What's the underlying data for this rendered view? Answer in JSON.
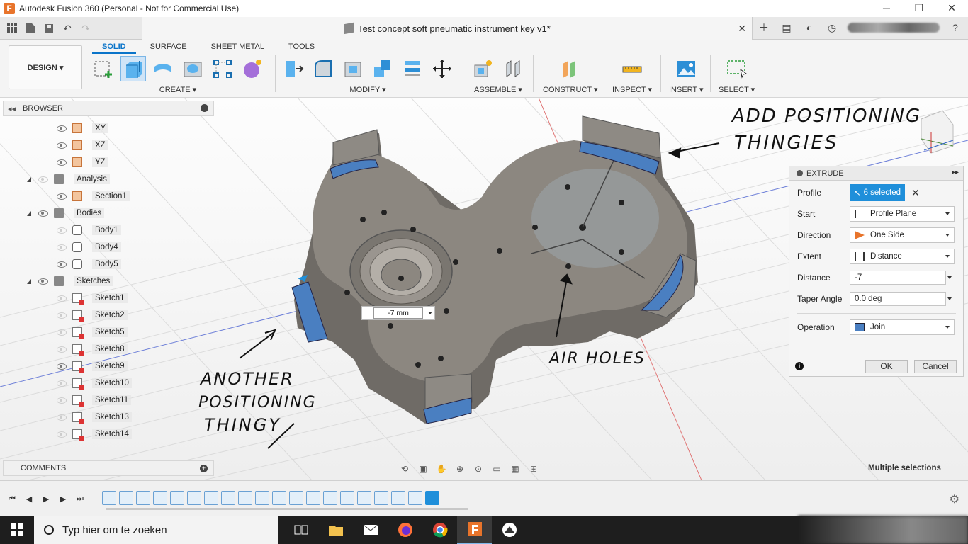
{
  "window": {
    "title": "Autodesk Fusion 360 (Personal - Not for Commercial Use)",
    "logo_letter": "F"
  },
  "document": {
    "title": "Test concept soft pneumatic instrument key v1*"
  },
  "toolbar": {
    "design_label": "DESIGN ▾",
    "tabs": [
      "SOLID",
      "SURFACE",
      "SHEET METAL",
      "TOOLS"
    ],
    "groups": {
      "create": "CREATE ▾",
      "modify": "MODIFY ▾",
      "assemble": "ASSEMBLE ▾",
      "construct": "CONSTRUCT ▾",
      "inspect": "INSPECT ▾",
      "insert": "INSERT ▾",
      "select": "SELECT ▾"
    }
  },
  "browser": {
    "title": "BROWSER",
    "items": [
      {
        "label": "XY",
        "type": "plane"
      },
      {
        "label": "XZ",
        "type": "plane"
      },
      {
        "label": "YZ",
        "type": "plane"
      },
      {
        "label": "Analysis",
        "type": "folder"
      },
      {
        "label": "Section1",
        "type": "plane"
      },
      {
        "label": "Bodies",
        "type": "folder"
      },
      {
        "label": "Body1",
        "type": "body"
      },
      {
        "label": "Body4",
        "type": "body"
      },
      {
        "label": "Body5",
        "type": "body"
      },
      {
        "label": "Sketches",
        "type": "folder"
      },
      {
        "label": "Sketch1",
        "type": "sketch"
      },
      {
        "label": "Sketch2",
        "type": "sketch"
      },
      {
        "label": "Sketch5",
        "type": "sketch"
      },
      {
        "label": "Sketch8",
        "type": "sketch"
      },
      {
        "label": "Sketch9",
        "type": "sketch"
      },
      {
        "label": "Sketch10",
        "type": "sketch"
      },
      {
        "label": "Sketch11",
        "type": "sketch"
      },
      {
        "label": "Sketch13",
        "type": "sketch"
      },
      {
        "label": "Sketch14",
        "type": "sketch"
      }
    ]
  },
  "comments": {
    "title": "COMMENTS"
  },
  "extrude": {
    "title": "EXTRUDE",
    "profile_label": "Profile",
    "profile_value": "6 selected",
    "start_label": "Start",
    "start_value": "Profile Plane",
    "direction_label": "Direction",
    "direction_value": "One Side",
    "extent_label": "Extent",
    "extent_value": "Distance",
    "distance_label": "Distance",
    "distance_value": "-7",
    "taper_label": "Taper Angle",
    "taper_value": "0.0 deg",
    "operation_label": "Operation",
    "operation_value": "Join",
    "ok_label": "OK",
    "cancel_label": "Cancel"
  },
  "viewport": {
    "dim_value": "-7 mm",
    "status": "Multiple selections",
    "annotations": {
      "top_right_1": "ADD POSITIONING",
      "top_right_2": "THINGIES",
      "bottom_left_1": "ANOTHER",
      "bottom_left_2": "POSITIONING",
      "bottom_left_3": "THINGY",
      "air_holes": "AIR HOLES"
    }
  },
  "taskbar": {
    "search_placeholder": "Typ hier om te zoeken"
  },
  "colors": {
    "accent": "#1f8fda",
    "body": "#8c8780",
    "selection": "#4a7fc1"
  }
}
